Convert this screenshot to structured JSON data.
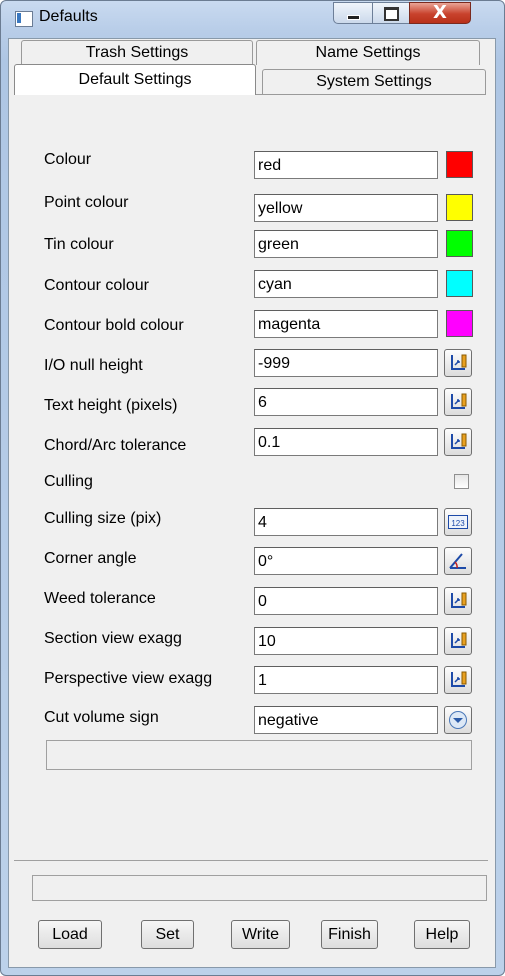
{
  "window": {
    "title": "Defaults",
    "close_glyph": "X"
  },
  "tabs": {
    "trash": "Trash Settings",
    "name": "Name Settings",
    "default": "Default Settings",
    "system": "System Settings"
  },
  "rows": [
    {
      "label": "Colour",
      "value": "red"
    },
    {
      "label": "Point colour",
      "value": "yellow"
    },
    {
      "label": "Tin colour",
      "value": "green"
    },
    {
      "label": "Contour colour",
      "value": "cyan"
    },
    {
      "label": "Contour bold colour",
      "value": "magenta"
    },
    {
      "label": "I/O null height",
      "value": "-999"
    },
    {
      "label": "Text height (pixels)",
      "value": "6"
    },
    {
      "label": "Chord/Arc tolerance",
      "value": "0.1"
    },
    {
      "label": "Culling",
      "value": ""
    },
    {
      "label": "Culling size (pix)",
      "value": "4"
    },
    {
      "label": "Corner angle",
      "value": "0°"
    },
    {
      "label": "Weed tolerance",
      "value": "0"
    },
    {
      "label": "Section view exagg",
      "value": "10"
    },
    {
      "label": "Perspective view exagg",
      "value": "1"
    },
    {
      "label": "Cut volume sign",
      "value": "negative"
    }
  ],
  "swatch_colors": [
    "#ff0000",
    "#ffff00",
    "#00ff00",
    "#00ffff",
    "#ff00ff"
  ],
  "icons": {
    "number_pick": "123",
    "pick": "measure-pick-icon",
    "angle": "angle-pick-icon",
    "dropdown": "chevron-down-icon"
  },
  "buttons": {
    "load": "Load",
    "set": "Set",
    "write": "Write",
    "finish": "Finish",
    "help": "Help"
  }
}
